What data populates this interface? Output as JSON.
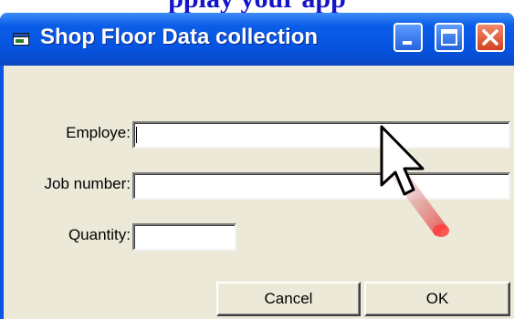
{
  "background_heading": "pplay your app",
  "window": {
    "title": "Shop Floor Data collection",
    "icon": "app-window-icon",
    "controls": {
      "minimize": "minimize-icon",
      "maximize": "maximize-icon",
      "close": "close-icon"
    }
  },
  "form": {
    "employee_label": "Employe:",
    "employee_value": "",
    "job_number_label": "Job number:",
    "job_number_value": "",
    "quantity_label": "Quantity:",
    "quantity_value": ""
  },
  "buttons": {
    "cancel": "Cancel",
    "ok": "OK"
  },
  "colors": {
    "titlebar": "#0553de",
    "client_bg": "#ece9d8",
    "close_button": "#d4411f",
    "heading_text": "#1414c8"
  }
}
